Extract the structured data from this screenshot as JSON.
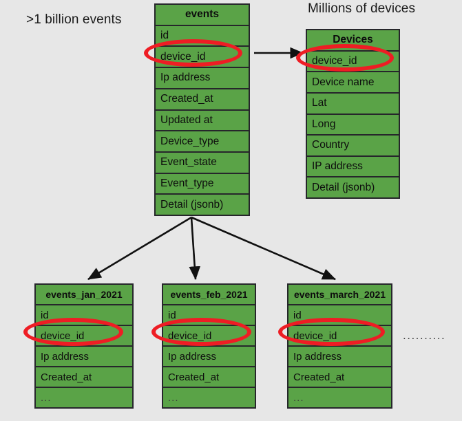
{
  "captions": {
    "events_scale": ">1 billion events",
    "devices_scale": "Millions of devices"
  },
  "tables": {
    "events": {
      "name": "events",
      "columns": [
        "id",
        "device_id",
        "Ip address",
        "Created_at",
        "Updated at",
        "Device_type",
        "Event_state",
        "Event_type",
        "Detail (jsonb)"
      ]
    },
    "devices": {
      "name": "Devices",
      "columns": [
        "device_id",
        "Device name",
        "Lat",
        "Long",
        "Country",
        "IP address",
        "Detail (jsonb)"
      ]
    },
    "events_jan": {
      "name": "events_jan_2021",
      "columns": [
        "id",
        "device_id",
        "Ip address",
        "Created_at",
        "..."
      ]
    },
    "events_feb": {
      "name": "events_feb_2021",
      "columns": [
        "id",
        "device_id",
        "Ip address",
        "Created_at",
        "..."
      ]
    },
    "events_march": {
      "name": "events_march_2021",
      "columns": [
        "id",
        "device_id",
        "Ip address",
        "Created_at",
        "..."
      ]
    }
  },
  "more_partitions_marker": "..........",
  "colors": {
    "background": "#e7e7e7",
    "table_fill": "#5aa347",
    "table_border": "#26262b",
    "highlight": "#ee1d24",
    "arrow": "#111111",
    "text": "#0d0d0d"
  }
}
